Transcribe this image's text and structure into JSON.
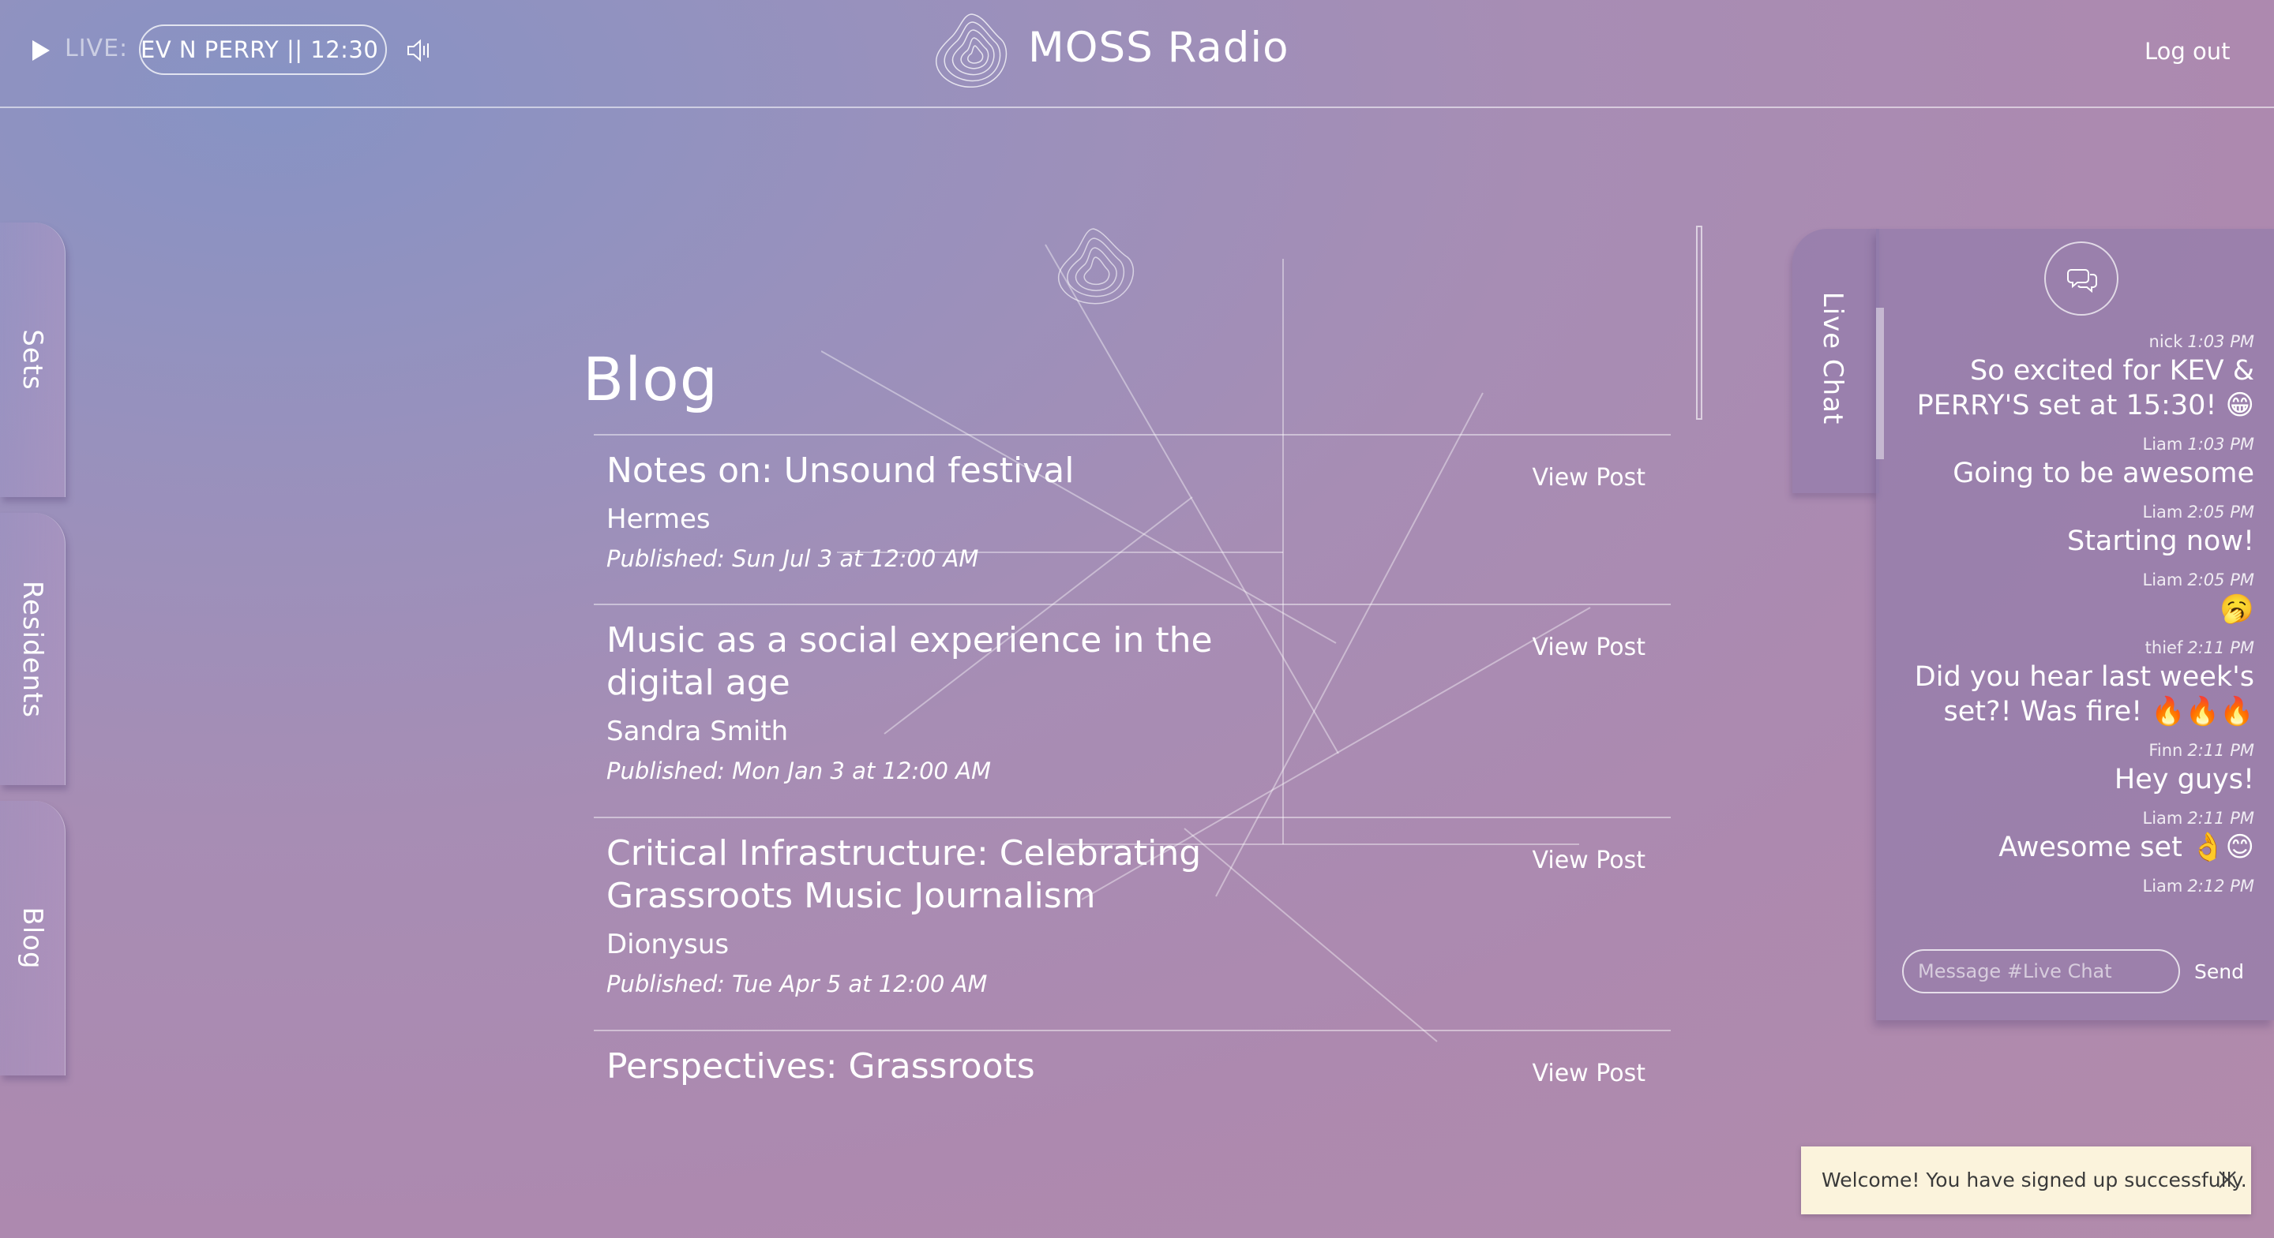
{
  "header": {
    "live_label": "LIVE:",
    "now_playing": "EV N PERRY || 12:30",
    "site_title": "MOSS Radio",
    "logout_label": "Log out"
  },
  "side_nav": {
    "items": [
      {
        "label": "Sets"
      },
      {
        "label": "Residents"
      },
      {
        "label": "Blog"
      }
    ]
  },
  "blog": {
    "title": "Blog",
    "posts": [
      {
        "title": "Notes on: Unsound festival",
        "author": "Hermes",
        "published": "Published: Sun Jul 3 at 12:00 AM",
        "view_label": "View Post"
      },
      {
        "title": "Music as a social experience in the digital age",
        "author": "Sandra Smith",
        "published": "Published: Mon Jan 3 at 12:00 AM",
        "view_label": "View Post"
      },
      {
        "title": "Critical Infrastructure: Celebrating Grassroots Music Journalism",
        "author": "Dionysus",
        "published": "Published: Tue Apr 5 at 12:00 AM",
        "view_label": "View Post"
      },
      {
        "title": "Perspectives: Grassroots",
        "author": "",
        "published": "",
        "view_label": "View Post"
      }
    ]
  },
  "chat": {
    "tab_label": "Live Chat",
    "messages": [
      {
        "user": "nick",
        "time": "1:03 PM",
        "text": "So excited for KEV & PERRY'S set at 15:30! 😁"
      },
      {
        "user": "Liam",
        "time": "1:03 PM",
        "text": "Going to be awesome"
      },
      {
        "user": "Liam",
        "time": "2:05 PM",
        "text": "Starting now!"
      },
      {
        "user": "Liam",
        "time": "2:05 PM",
        "text": "🥱"
      },
      {
        "user": "thief",
        "time": "2:11 PM",
        "text": "Did you hear last week's set?! Was fire! 🔥🔥🔥"
      },
      {
        "user": "Finn",
        "time": "2:11 PM",
        "text": "Hey guys!"
      },
      {
        "user": "Liam",
        "time": "2:11 PM",
        "text": "Awesome set 👌😊"
      },
      {
        "user": "Liam",
        "time": "2:12 PM",
        "text": ""
      }
    ],
    "input_placeholder": "Message #Live Chat",
    "send_label": "Send"
  },
  "toast": {
    "text": "Welcome! You have signed up successfully."
  }
}
